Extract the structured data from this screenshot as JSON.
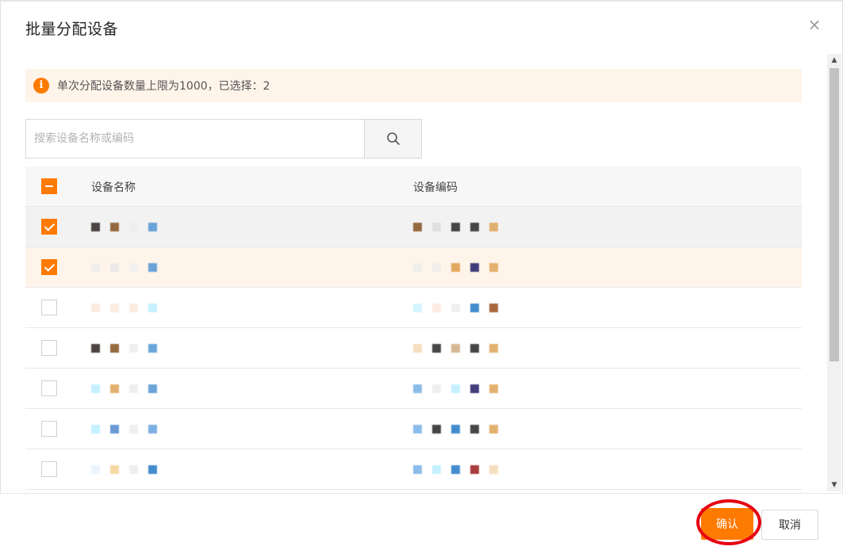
{
  "dialog": {
    "title": "批量分配设备",
    "close_symbol": "×"
  },
  "notice": {
    "icon_symbol": "i",
    "text": "单次分配设备数量上限为1000，已选择：2",
    "accent_color": "#ff7a00"
  },
  "search": {
    "placeholder": "搜索设备名称或编码",
    "value": "",
    "icon": "search-icon"
  },
  "table": {
    "headers": {
      "name": "设备名称",
      "code": "设备编码"
    },
    "select_all_state": "partial",
    "rows": [
      {
        "checked": true
      },
      {
        "checked": true
      },
      {
        "checked": false
      },
      {
        "checked": false
      },
      {
        "checked": false
      },
      {
        "checked": false
      },
      {
        "checked": false
      }
    ]
  },
  "footer": {
    "confirm_label": "确认",
    "cancel_label": "取消"
  },
  "colors": {
    "accent": "#ff7a00",
    "notice_bg": "#fff4ea",
    "annotation": "#e60012"
  }
}
